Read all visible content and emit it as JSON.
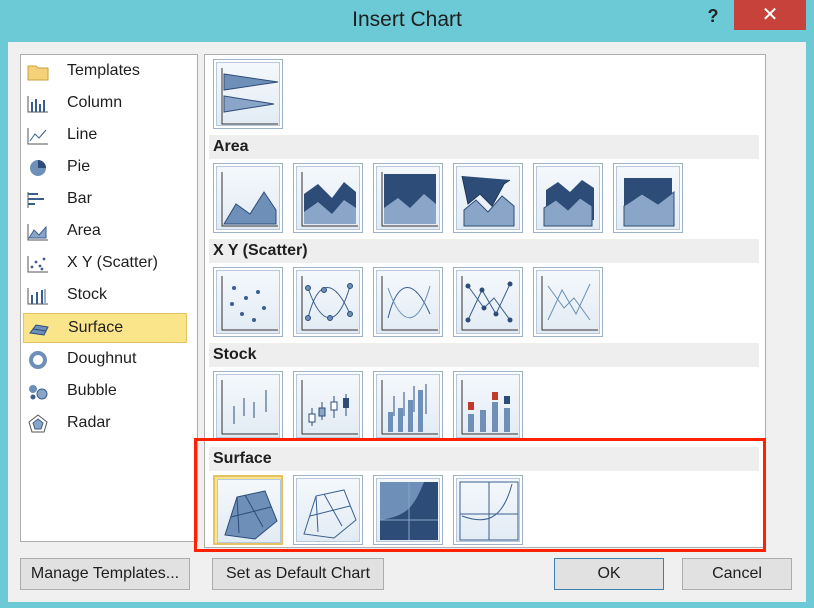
{
  "window": {
    "title": "Insert Chart",
    "help": "?",
    "close": "✕"
  },
  "chart_types": [
    {
      "label": "Templates",
      "icon": "folder-icon"
    },
    {
      "label": "Column",
      "icon": "column-chart-icon"
    },
    {
      "label": "Line",
      "icon": "line-chart-icon"
    },
    {
      "label": "Pie",
      "icon": "pie-chart-icon"
    },
    {
      "label": "Bar",
      "icon": "bar-chart-icon"
    },
    {
      "label": "Area",
      "icon": "area-chart-icon"
    },
    {
      "label": "X Y (Scatter)",
      "icon": "scatter-chart-icon"
    },
    {
      "label": "Stock",
      "icon": "stock-chart-icon"
    },
    {
      "label": "Surface",
      "icon": "surface-chart-icon",
      "selected": true
    },
    {
      "label": "Doughnut",
      "icon": "doughnut-chart-icon"
    },
    {
      "label": "Bubble",
      "icon": "bubble-chart-icon"
    },
    {
      "label": "Radar",
      "icon": "radar-chart-icon"
    }
  ],
  "gallery": {
    "sections": [
      {
        "title": "Area",
        "count": 6
      },
      {
        "title": "X Y (Scatter)",
        "count": 5
      },
      {
        "title": "Stock",
        "count": 4
      },
      {
        "title": "Surface",
        "count": 4,
        "selected_index": 0
      }
    ]
  },
  "buttons": {
    "manage_templates": "Manage Templates...",
    "set_default": "Set as Default Chart",
    "ok": "OK",
    "cancel": "Cancel"
  },
  "colors": {
    "highlight": "#ff2200",
    "selection": "#fbe58a",
    "close": "#c8423c"
  }
}
